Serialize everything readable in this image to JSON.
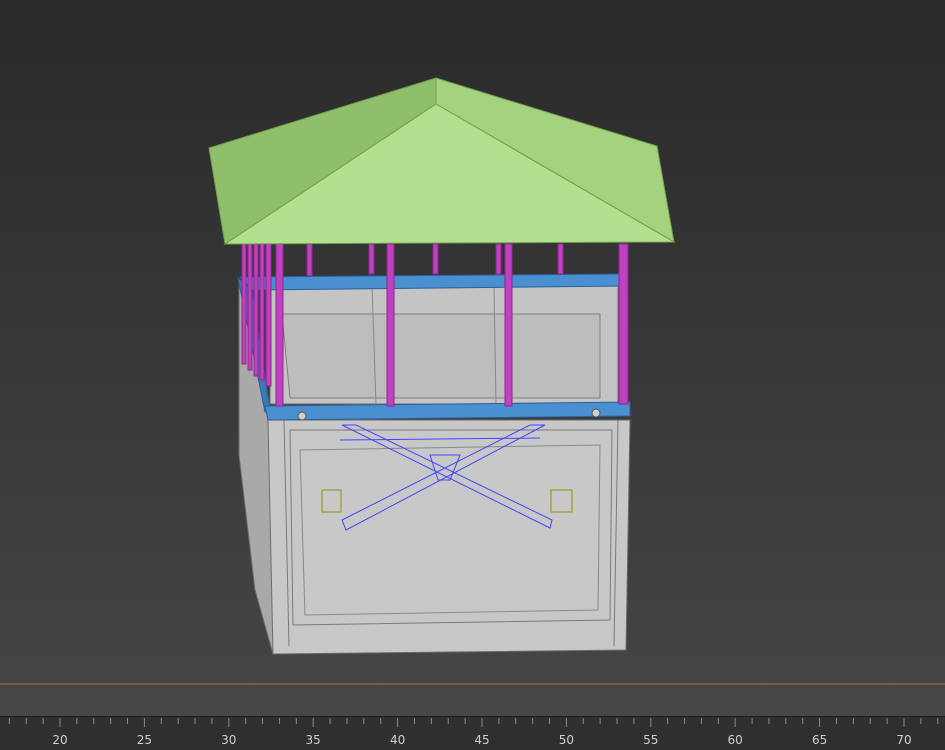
{
  "viewport": {
    "name": "perspective-viewport",
    "background_top": "#2a2a2a",
    "background_bottom": "#464646",
    "ground_line_color": "#a07a2a"
  },
  "model": {
    "roof_color": "#b3e08f",
    "roof_shadow_color": "#8fbf6a",
    "post_color": "#c040c0",
    "deck_frame_color": "#4a8fd0",
    "box_color": "#c8c8c8",
    "box_edge_color": "#6c6c6c",
    "brace_color": "#4444ff",
    "bolt_color": "#9a9a2a"
  },
  "timeline": {
    "ticks": [
      {
        "label": "20"
      },
      {
        "label": "25"
      },
      {
        "label": "30"
      },
      {
        "label": "35"
      },
      {
        "label": "40"
      },
      {
        "label": "45"
      },
      {
        "label": "50"
      },
      {
        "label": "55"
      },
      {
        "label": "60"
      },
      {
        "label": "65"
      },
      {
        "label": "70"
      }
    ],
    "tick_values": [
      20,
      25,
      30,
      35,
      40,
      45,
      50,
      55,
      60,
      65,
      70
    ],
    "range": [
      15,
      72
    ]
  }
}
